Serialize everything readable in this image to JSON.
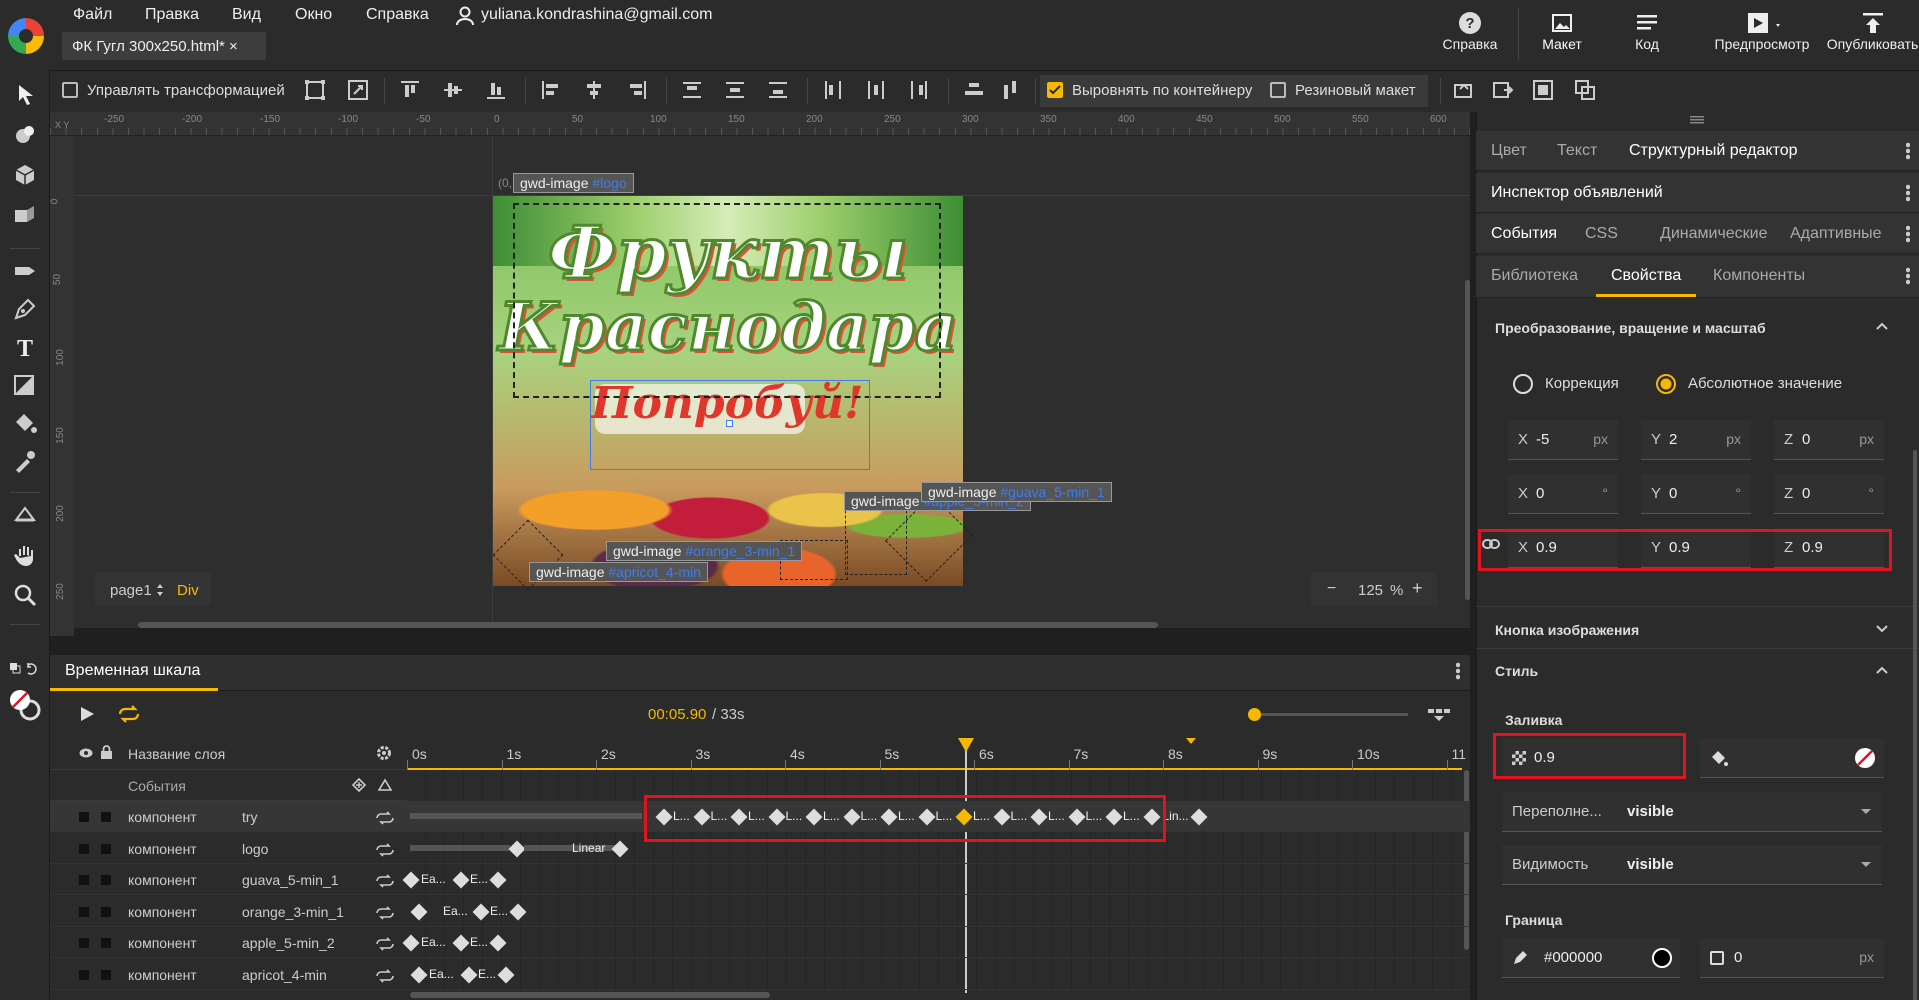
{
  "menu": {
    "file": "Файл",
    "edit": "Правка",
    "view": "Вид",
    "window": "Окно",
    "help": "Справка",
    "user": "yuliana.kondrashina@gmail.com"
  },
  "doc_tab": "ФК Гугл 300x250.html* ×",
  "top_buttons": {
    "help": "Справка",
    "layout": "Макет",
    "code": "Код",
    "preview": "Предпросмотр",
    "publish": "Опубликовать"
  },
  "toolbar": {
    "manage_transform": "Управлять трансформацией",
    "align_container": "Выровнять по контейнеру",
    "rubber_layout": "Резиновый макет"
  },
  "ruler_h": [
    "-250",
    "-200",
    "-150",
    "-100",
    "-50",
    "0",
    "50",
    "100",
    "150",
    "200",
    "250",
    "300",
    "350",
    "400",
    "450",
    "500",
    "550",
    "600"
  ],
  "ruler_v": [
    "0",
    "50",
    "100",
    "150",
    "200",
    "250"
  ],
  "ruler_xy": "X Y",
  "stage": {
    "origin_label": "(0,",
    "tags": [
      {
        "kind": "gwd-image",
        "id": "#logo"
      },
      {
        "kind": "gwd-image",
        "id": "#guava_5-min_1"
      },
      {
        "kind": "gwd-image",
        "id": "#apple_5-min_2"
      },
      {
        "kind": "gwd-image",
        "id": "#orange_3-min_1"
      },
      {
        "kind": "gwd-image",
        "id": "#apricot_4-min"
      }
    ],
    "ad_title_1": "Фрукты",
    "ad_title_2": "Краснодара",
    "ad_try": "Попробуй!",
    "page_selector": "page1",
    "element_type": "Div",
    "zoom_minus": "−",
    "zoom": "125",
    "zoom_unit": "%",
    "zoom_plus": "+"
  },
  "timeline": {
    "title": "Временная шкала",
    "time": "00:05.90",
    "duration": "/ 33s",
    "layer_name_header": "Название слоя",
    "events_label": "События",
    "ticks": [
      "0s",
      "1s",
      "2s",
      "3s",
      "4s",
      "5s",
      "6s",
      "7s",
      "8s",
      "9s",
      "10s",
      "11"
    ],
    "playhead_fraction": 0.59,
    "rows": [
      {
        "type": "компонент",
        "name": "try",
        "tween": "L...",
        "end": "Lin..."
      },
      {
        "type": "компонент",
        "name": "logo",
        "tween": "Linear"
      },
      {
        "type": "компонент",
        "name": "guava_5-min_1",
        "a": "Ea...",
        "b": "E..."
      },
      {
        "type": "компонент",
        "name": "orange_3-min_1",
        "a": "Ea...",
        "b": "E..."
      },
      {
        "type": "компонент",
        "name": "apple_5-min_2",
        "a": "Ea...",
        "b": "E..."
      },
      {
        "type": "компонент",
        "name": "apricot_4-min",
        "a": "Ea...",
        "b": "E..."
      }
    ]
  },
  "panel": {
    "tabs1": [
      "Цвет",
      "Текст",
      "Структурный редактор"
    ],
    "ads_inspector": "Инспектор объявлений",
    "tabs2": [
      "События",
      "CSS",
      "Динамические",
      "Адаптивные"
    ],
    "tabs3": [
      "Библиотека",
      "Свойства",
      "Компоненты"
    ],
    "transform_section": "Преобразование, вращение и масштаб",
    "radio_correction": "Коррекция",
    "radio_absolute": "Абсолютное значение",
    "translate": {
      "x": "-5",
      "y": "2",
      "z": "0",
      "unit": "px"
    },
    "rotate": {
      "x": "0",
      "y": "0",
      "z": "0",
      "unit": "°"
    },
    "scale": {
      "x": "0.9",
      "y": "0.9",
      "z": "0.9"
    },
    "image_button": "Кнопка изображения",
    "style": "Стиль",
    "fill": "Заливка",
    "fill_value": "0.9",
    "overflow_label": "Переполне...",
    "overflow_value": "visible",
    "visibility_label": "Видимость",
    "visibility_value": "visible",
    "border": "Граница",
    "border_color": "#000000",
    "border_width": "0",
    "border_unit": "px"
  },
  "colors": {
    "accent": "#f6b900",
    "highlight": "#e0131f",
    "link": "#3d7df2"
  }
}
